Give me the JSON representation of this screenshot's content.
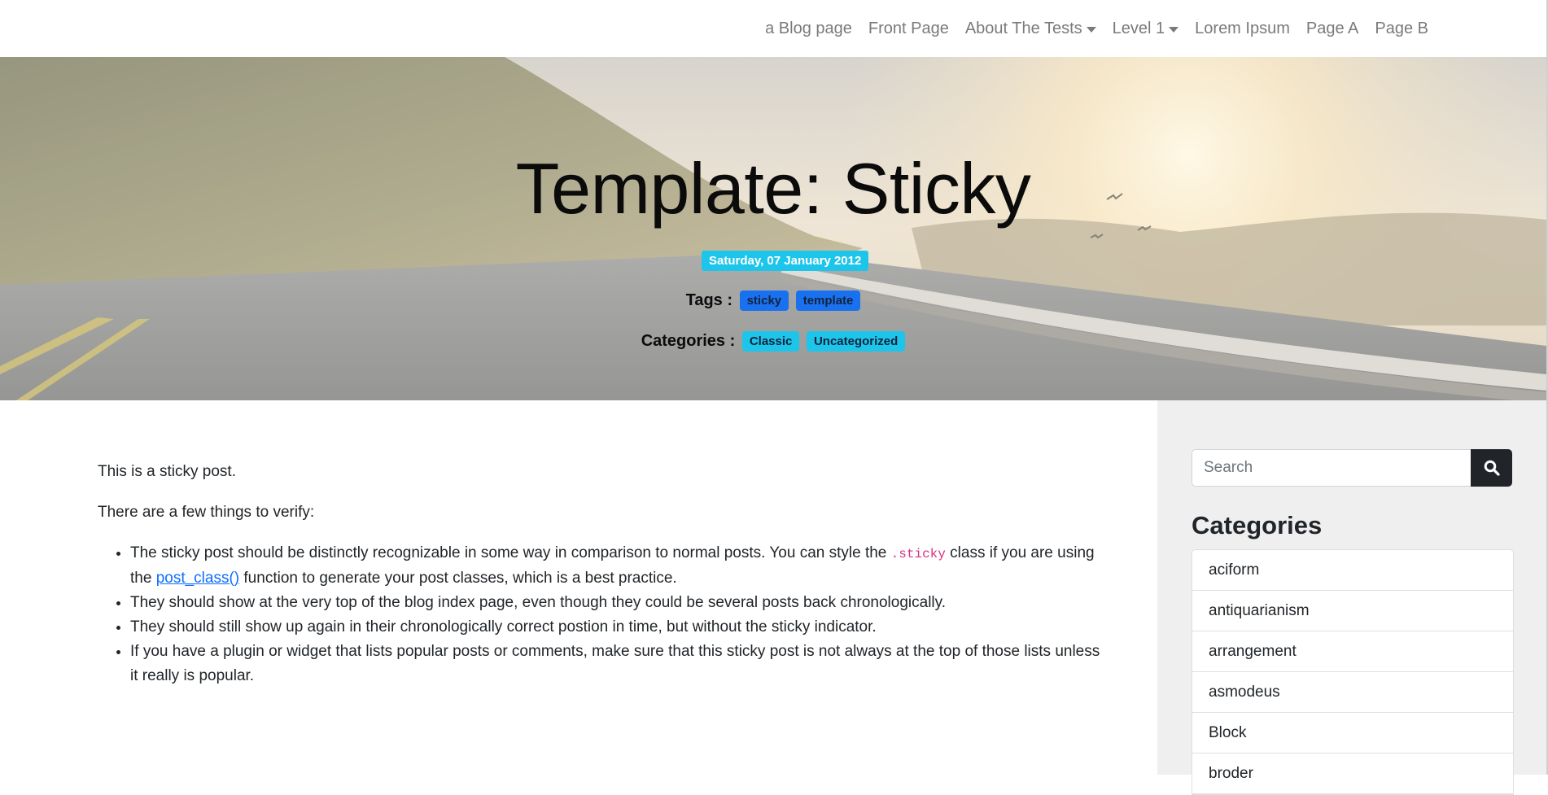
{
  "navbar": {
    "items": [
      {
        "label": "a Blog page",
        "dropdown": false
      },
      {
        "label": "Front Page",
        "dropdown": false
      },
      {
        "label": "About The Tests",
        "dropdown": true
      },
      {
        "label": "Level 1",
        "dropdown": true
      },
      {
        "label": "Lorem Ipsum",
        "dropdown": false
      },
      {
        "label": "Page A",
        "dropdown": false
      },
      {
        "label": "Page B",
        "dropdown": false
      }
    ]
  },
  "hero": {
    "title": "Template: Sticky",
    "date": "Saturday, 07 January 2012",
    "tags_label": "Tags :",
    "tags": [
      "sticky",
      "template"
    ],
    "categories_label": "Categories :",
    "categories": [
      "Classic",
      "Uncategorized"
    ]
  },
  "post": {
    "intro": "This is a sticky post.",
    "lead": "There are a few things to verify:",
    "bullet1_part1": "The sticky post should be distinctly recognizable in some way in comparison to normal posts. You can style the ",
    "bullet1_code": ".sticky",
    "bullet1_part2": " class if you are using the ",
    "bullet1_link": "post_class()",
    "bullet1_part3": " function to generate your post classes, which is a best practice.",
    "bullet2": "They should show at the very top of the blog index page, even though they could be several posts back chronologically.",
    "bullet3": "They should still show up again in their chronologically correct postion in time, but without the sticky indicator.",
    "bullet4": "If you have a plugin or widget that lists popular posts or comments, make sure that this sticky post is not always at the top of those lists unless it really is popular."
  },
  "sidebar": {
    "search_placeholder": "Search",
    "categories_heading": "Categories",
    "categories": [
      "aciform",
      "antiquarianism",
      "arrangement",
      "asmodeus",
      "Block",
      "broder"
    ]
  },
  "colors": {
    "date_badge": "#1ec5ea",
    "tag_badge": "#1a71f0",
    "category_badge": "#1ec5ea",
    "link": "#0d6efd",
    "code": "#d63384",
    "search_button": "#212529",
    "sidebar_bg": "#efefef"
  },
  "icons": {
    "search_button": "search-icon",
    "dropdown": "caret-down-icon"
  }
}
